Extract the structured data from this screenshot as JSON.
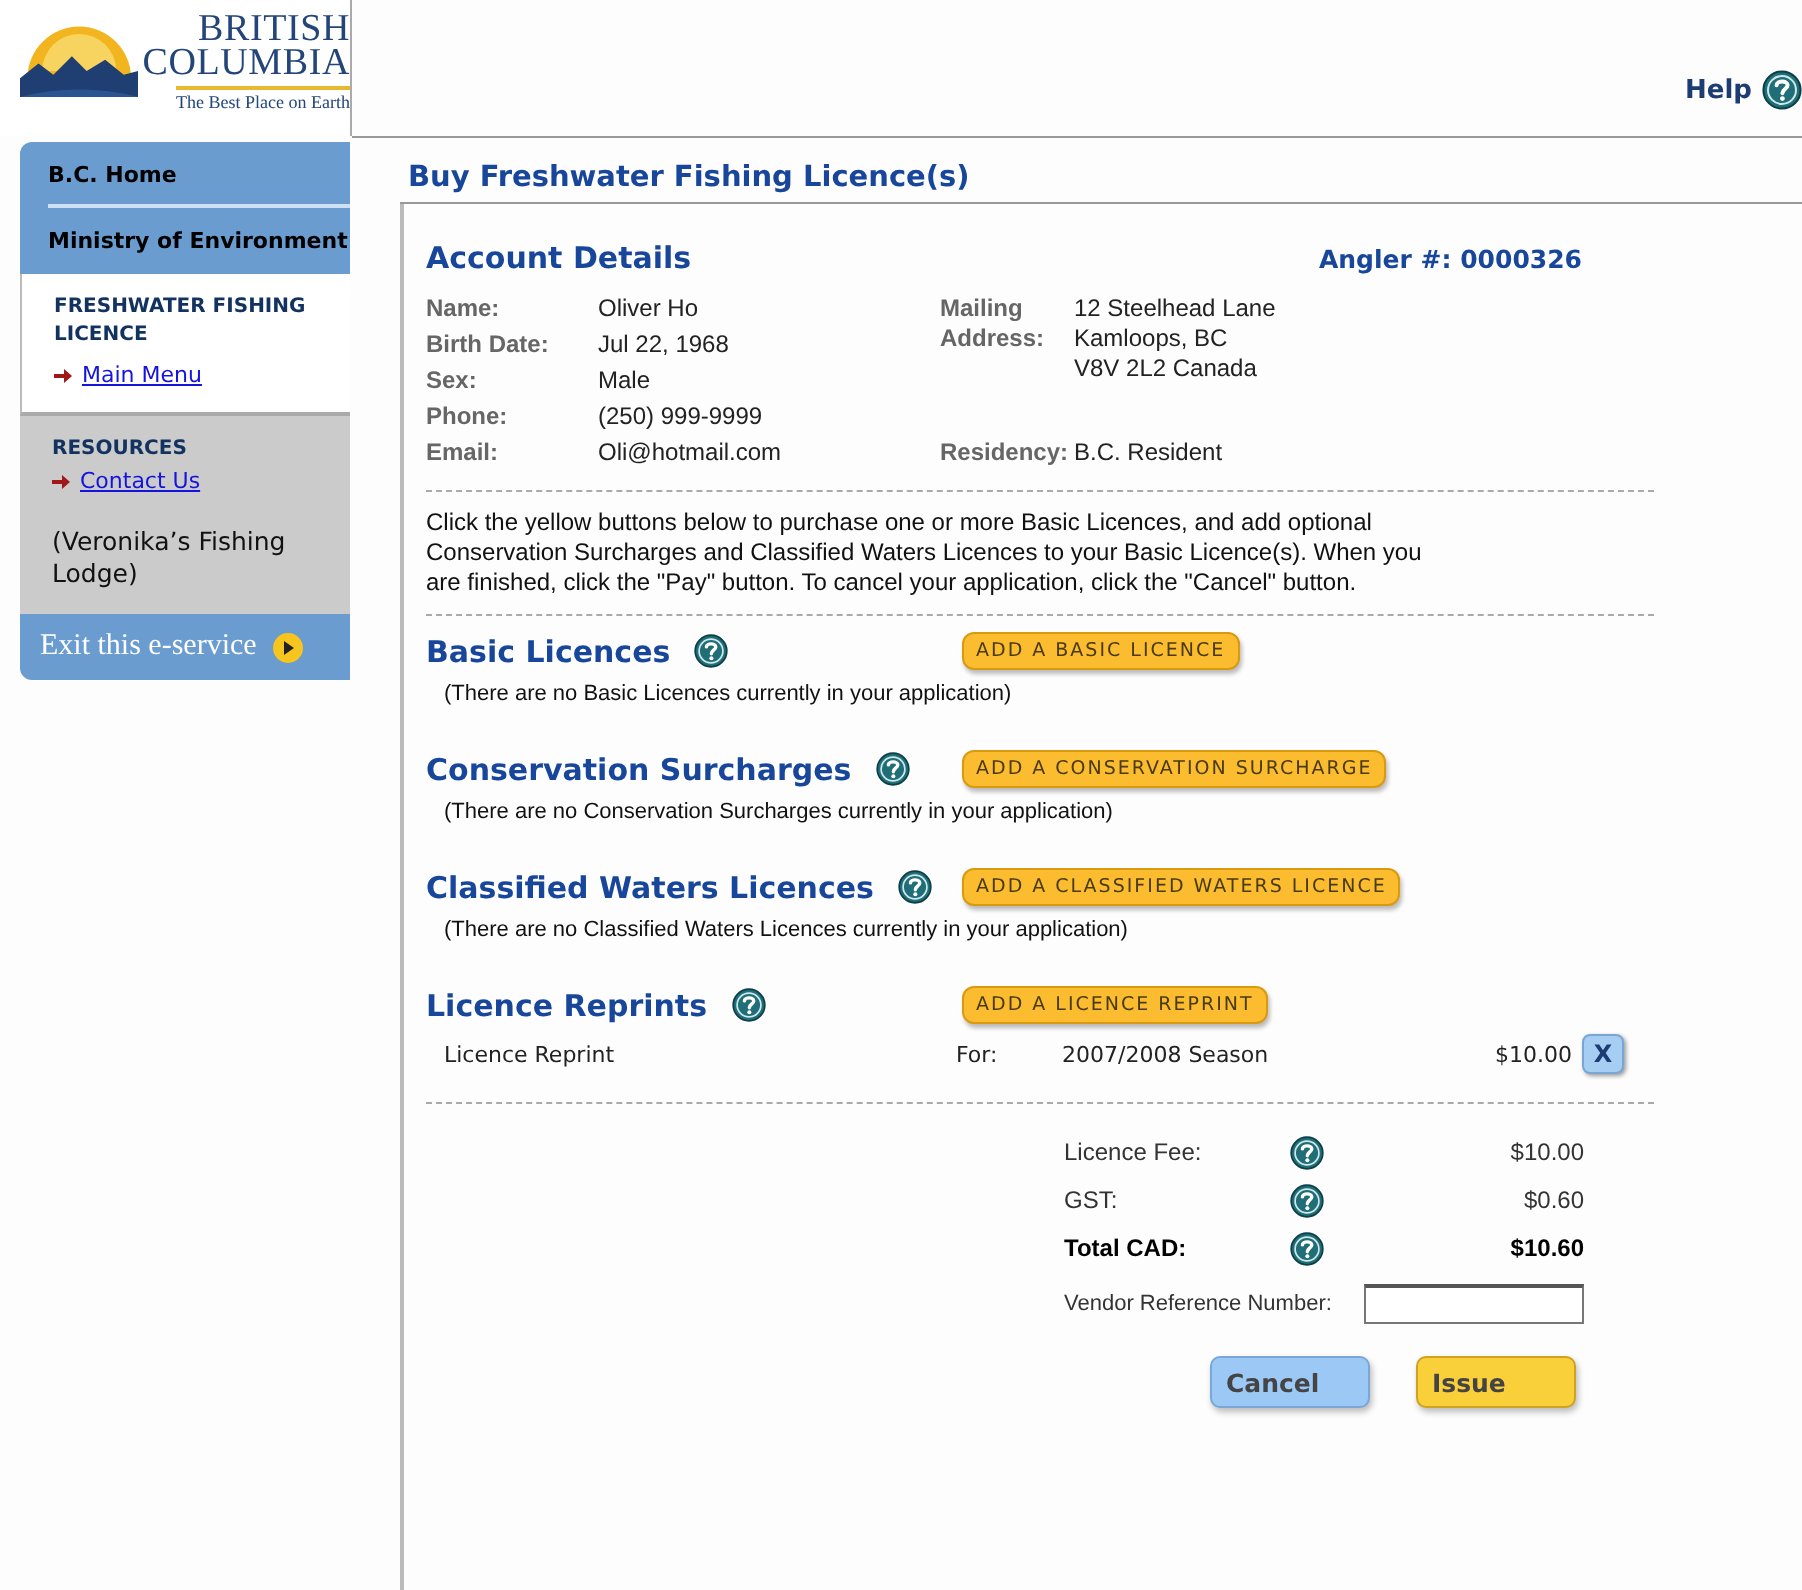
{
  "header": {
    "logo": {
      "line_1": "BRITISH",
      "line_2": "COLUMBIA",
      "tagline": "The Best Place on Earth"
    },
    "help": "Help"
  },
  "sidebar": {
    "top_links": [
      "B.C. Home",
      "Ministry of Environment"
    ],
    "service": {
      "title": "FRESHWATER FISHING LICENCE",
      "links": [
        "Main Menu"
      ]
    },
    "resources": {
      "title": "RESOURCES",
      "links": [
        "Contact Us"
      ],
      "vendor": "(Veronika’s Fishing Lodge)"
    },
    "exit": "Exit this e-service"
  },
  "page_title": "Buy Freshwater Fishing Licence(s)",
  "account": {
    "title": "Account Details",
    "angler": "Angler #: 0000326",
    "fields": [
      {
        "label": "Name:",
        "value": "Oliver Ho"
      },
      {
        "label": "Birth Date:",
        "value": "Jul 22, 1968"
      },
      {
        "label": "Sex:",
        "value": "Male"
      },
      {
        "label": "Phone:",
        "value": "(250) 999-9999"
      },
      {
        "label": "Email:",
        "value": "Oli@hotmail.com"
      }
    ],
    "mailing": {
      "label": [
        "Mailing",
        "Address:"
      ],
      "lines": [
        "12 Steelhead Lane",
        "Kamloops, BC",
        "V8V 2L2 Canada"
      ]
    },
    "residency": {
      "label": "Residency:",
      "value": "B.C. Resident"
    }
  },
  "instructions": "Click the yellow buttons below to purchase one or more Basic Licences, and add optional Conservation Surcharges and Classified Waters Licences to your Basic Licence(s). When you are finished, click the \"Pay\" button. To cancel your application, click the \"Cancel\" button.",
  "sections": [
    {
      "title": "Basic Licences",
      "button": "ADD A BASIC LICENCE",
      "empty": "(There are no Basic Licences currently in your application)"
    },
    {
      "title": "Conservation Surcharges",
      "button": "ADD A CONSERVATION SURCHARGE",
      "empty": "(There are no Conservation Surcharges currently in your application)"
    },
    {
      "title": "Classified Waters Licences",
      "button": "ADD A CLASSIFIED WATERS LICENCE",
      "empty": "(There are no Classified Waters Licences currently in your application)"
    },
    {
      "title": "Licence Reprints",
      "button": "ADD A LICENCE REPRINT",
      "items": [
        {
          "name": "Licence Reprint",
          "for_label": "For:",
          "season": "2007/2008 Season",
          "price": "$10.00",
          "remove": "X"
        }
      ]
    }
  ],
  "totals": [
    {
      "label": "Licence Fee:",
      "value": "$10.00",
      "bold": false
    },
    {
      "label": "GST:",
      "value": "$0.60",
      "bold": false
    },
    {
      "label": "Total CAD:",
      "value": "$10.60",
      "bold": true
    }
  ],
  "vendor_reference": {
    "label": "Vendor Reference Number:"
  },
  "actions": [
    {
      "label": "Cancel",
      "kind": "cancel"
    },
    {
      "label": "Issue",
      "kind": "primary"
    }
  ]
}
